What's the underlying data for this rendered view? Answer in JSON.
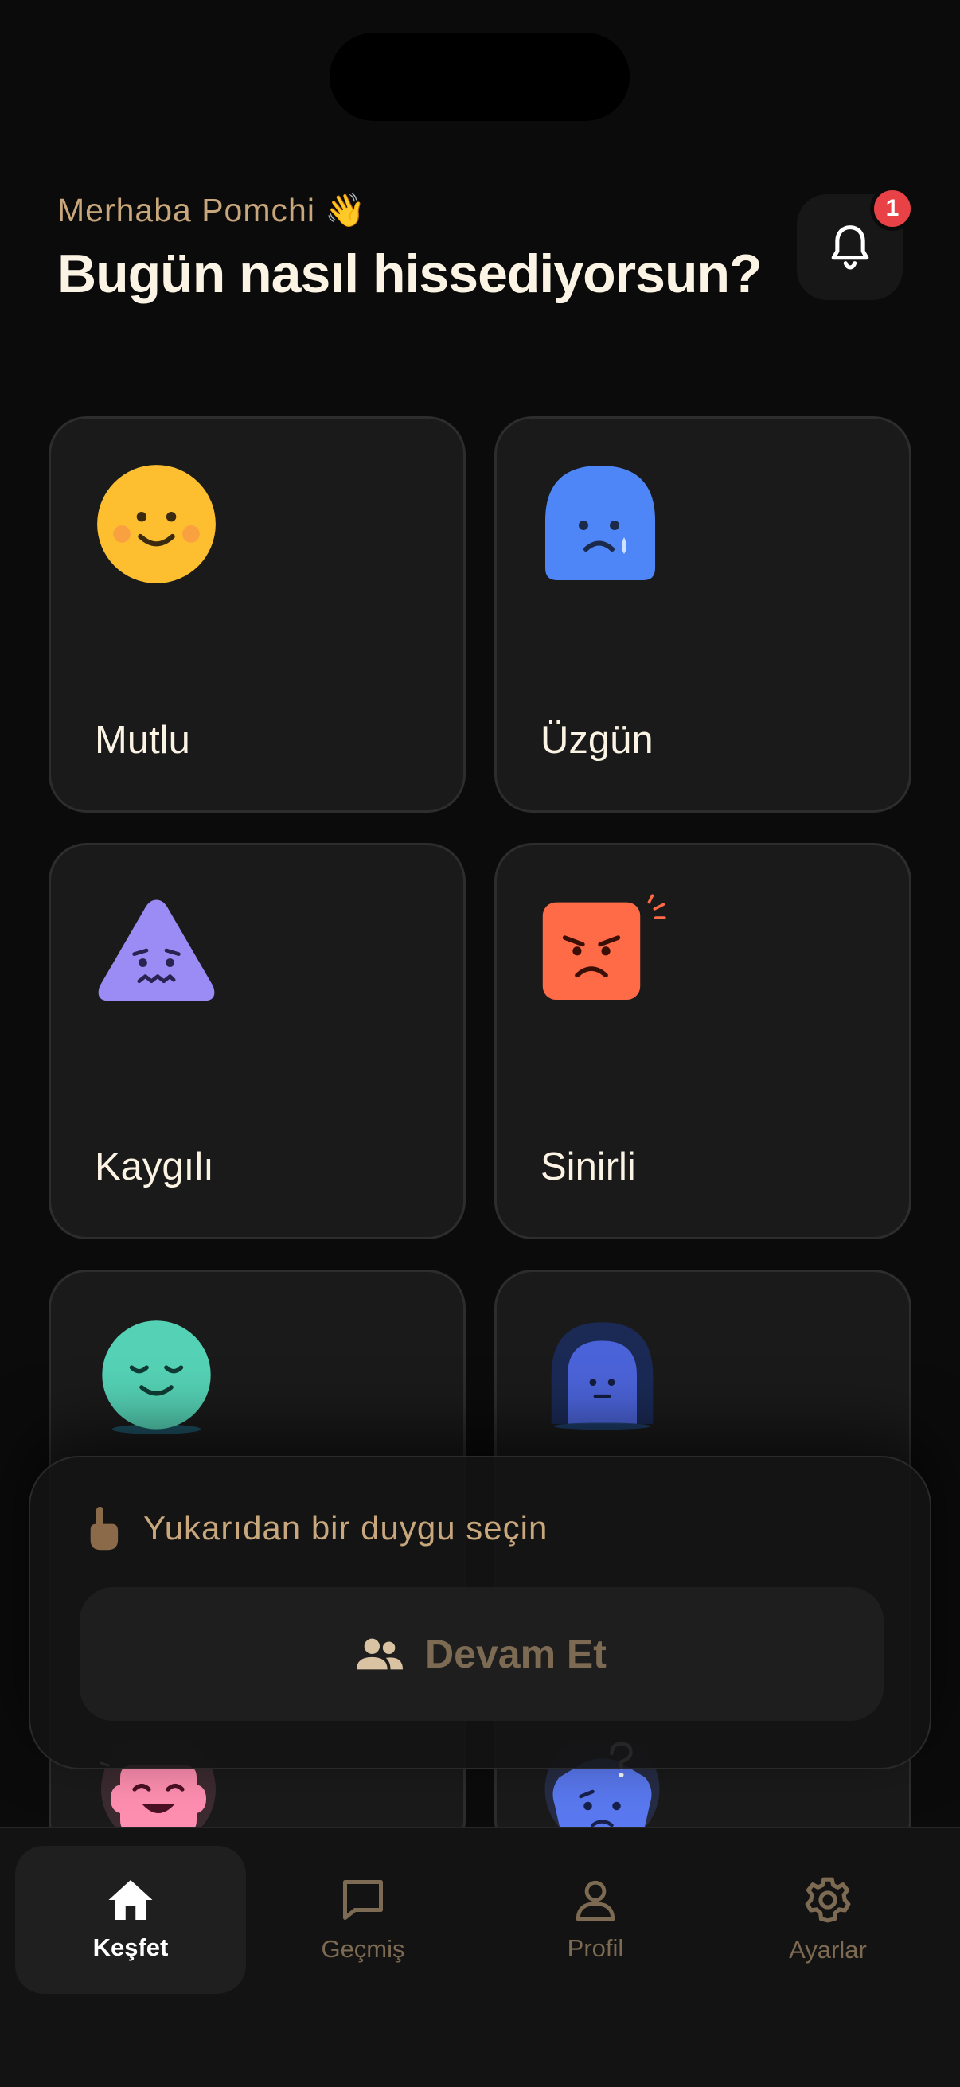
{
  "header": {
    "greeting": "Merhaba Pomchi",
    "greeting_emoji": "👋",
    "title": "Bugün nasıl hissediyorsun?",
    "notification_count": "1"
  },
  "moods": [
    {
      "label": "Mutlu",
      "icon": "happy-face-icon",
      "color": "#fdbf30"
    },
    {
      "label": "Üzgün",
      "icon": "sad-face-icon",
      "color": "#4f86f7"
    },
    {
      "label": "Kaygılı",
      "icon": "anxious-face-icon",
      "color": "#9b8cf5"
    },
    {
      "label": "Sinirli",
      "icon": "angry-face-icon",
      "color": "#ff6b47"
    },
    {
      "label": "",
      "icon": "calm-face-icon",
      "color": "#55d2b5"
    },
    {
      "label": "",
      "icon": "lonely-face-icon",
      "color": "#4b63d8"
    },
    {
      "label": "",
      "icon": "excited-face-icon",
      "color": "#ff8fb1"
    },
    {
      "label": "",
      "icon": "confused-face-icon",
      "color": "#5a79f0"
    }
  ],
  "sheet": {
    "hint": "Yukarıdan bir duygu seçin",
    "continue_label": "Devam Et"
  },
  "nav": {
    "items": [
      {
        "label": "Keşfet",
        "icon": "home-icon",
        "active": true
      },
      {
        "label": "Geçmiş",
        "icon": "chat-icon",
        "active": false
      },
      {
        "label": "Profil",
        "icon": "user-icon",
        "active": false
      },
      {
        "label": "Ayarlar",
        "icon": "settings-icon",
        "active": false
      }
    ]
  },
  "colors": {
    "background": "#0b0b0b",
    "accent_text": "#c9a77c",
    "badge": "#e84246"
  }
}
